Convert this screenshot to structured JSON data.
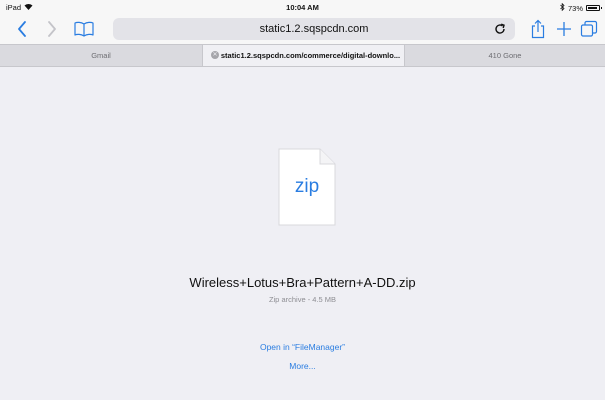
{
  "status_bar": {
    "device": "iPad",
    "time": "10:04 AM",
    "battery_text": "73%",
    "battery_level": 0.73
  },
  "toolbar": {
    "address": "static1.2.sqspcdn.com"
  },
  "tabs": [
    {
      "label": "Gmail"
    },
    {
      "label": "static1.2.sqspcdn.com/commerce/digital-downlo..."
    },
    {
      "label": "410 Gone"
    }
  ],
  "file": {
    "extension": "zip",
    "name": "Wireless+Lotus+Bra+Pattern+A-DD.zip",
    "meta": "Zip archive - 4.5 MB"
  },
  "actions": {
    "open_in": "Open in “FileManager”",
    "more": "More..."
  },
  "colors": {
    "accent": "#2a7de1",
    "background": "#efeff4"
  }
}
